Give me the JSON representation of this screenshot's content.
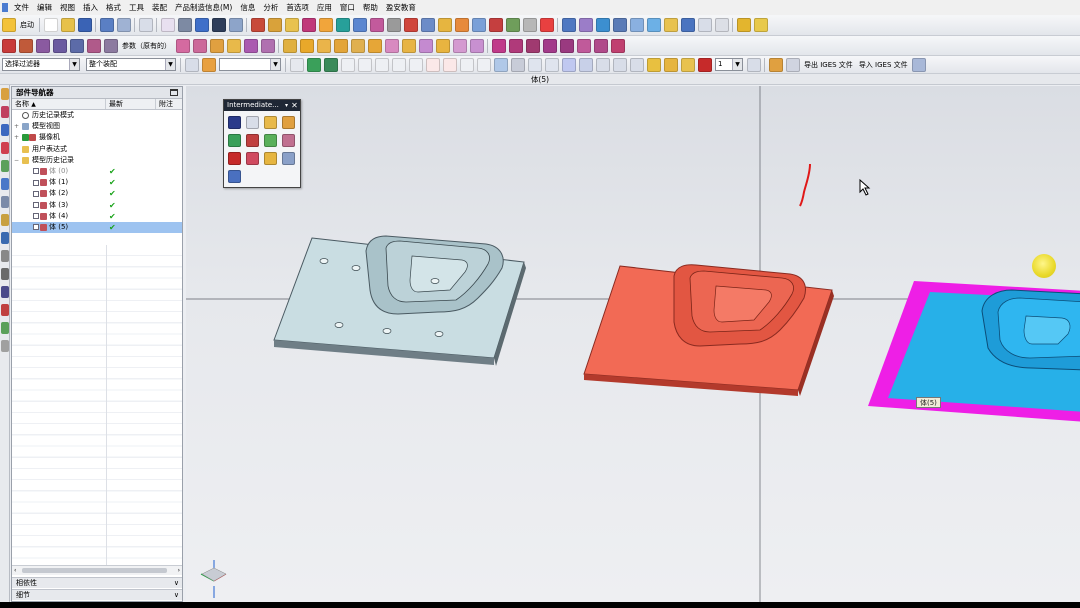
{
  "menu": {
    "items": [
      "文件",
      "编辑",
      "视图",
      "插入",
      "格式",
      "工具",
      "装配",
      "产品制造信息(M)",
      "信息",
      "分析",
      "首选项",
      "应用",
      "窗口",
      "帮助",
      "盈安教育"
    ]
  },
  "toolbar1": {
    "start_label": "启动"
  },
  "toolbar2": {
    "params_label": "参数（原有的）"
  },
  "toolbar3": {
    "filter_value": "选择过滤器",
    "assembly_value": "整个装配",
    "empty_combo": "",
    "layer_value": "1",
    "export_iges": "导出 IGES 文件",
    "import_iges": "导入 IGES 文件"
  },
  "window_title": "体(5)",
  "navigator": {
    "title": "部件导航器",
    "columns": [
      "名称",
      "最新",
      "附注"
    ],
    "rows": [
      {
        "label": "历史记录模式",
        "latest": false,
        "selected": false,
        "dim": false
      },
      {
        "label": "模型视图",
        "latest": false,
        "selected": false,
        "dim": false
      },
      {
        "label": "摄像机",
        "latest": false,
        "selected": false,
        "dim": false
      },
      {
        "label": "用户表达式",
        "latest": false,
        "selected": false,
        "dim": false
      },
      {
        "label": "模型历史记录",
        "latest": false,
        "selected": false,
        "dim": false
      },
      {
        "label": "体 (0)",
        "latest": true,
        "selected": false,
        "dim": true
      },
      {
        "label": "体 (1)",
        "latest": true,
        "selected": false,
        "dim": false
      },
      {
        "label": "体 (2)",
        "latest": true,
        "selected": false,
        "dim": false
      },
      {
        "label": "体 (3)",
        "latest": true,
        "selected": false,
        "dim": false
      },
      {
        "label": "体 (4)",
        "latest": true,
        "selected": false,
        "dim": false
      },
      {
        "label": "体 (5)",
        "latest": true,
        "selected": true,
        "dim": false
      }
    ],
    "sections": [
      "相依性",
      "细节"
    ]
  },
  "palette": {
    "title": "Intermediate..."
  },
  "viewport": {
    "hover_label": "体(5)"
  },
  "colors": {
    "accent_select": "#9dc3f0",
    "part_gray": "#c9dde2",
    "part_red": "#f26a55",
    "part_cyan": "#27b0e8",
    "part_magenta": "#ee1fe6",
    "palette_title": "#1f2735"
  }
}
